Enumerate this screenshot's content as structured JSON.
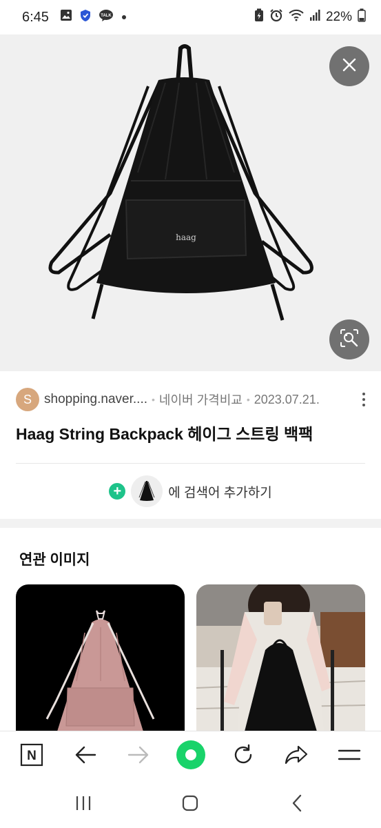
{
  "status_bar": {
    "time": "6:45",
    "battery": "22%",
    "icons_left": [
      "gallery-icon",
      "shield-icon",
      "talk-icon",
      "dot-icon"
    ],
    "icons_right": [
      "battery-saver-icon",
      "alarm-icon",
      "wifi-icon",
      "signal-icon",
      "battery-icon"
    ],
    "talk_badge": "TALK"
  },
  "hero": {
    "image_label": "haag",
    "close_icon": "close-icon",
    "lens_icon": "image-search-icon"
  },
  "result": {
    "avatar_letter": "S",
    "domain": "shopping.naver....",
    "provider": "네이버 가격비교",
    "date": "2023.07.21.",
    "title": "Haag String Backpack 헤이그 스트링 백팩",
    "add_search_label": "에 검색어 추가하기"
  },
  "related": {
    "heading": "연관 이미지"
  },
  "toolbar": {
    "items": [
      "naver-home-icon",
      "back-arrow-icon",
      "forward-arrow-icon",
      "green-dot-button",
      "refresh-icon",
      "share-icon",
      "menu-icon"
    ],
    "home_letter": "N",
    "accent_color": "#19d36a"
  },
  "nav": {
    "items": [
      "recent-apps-icon",
      "home-icon",
      "back-icon"
    ]
  }
}
